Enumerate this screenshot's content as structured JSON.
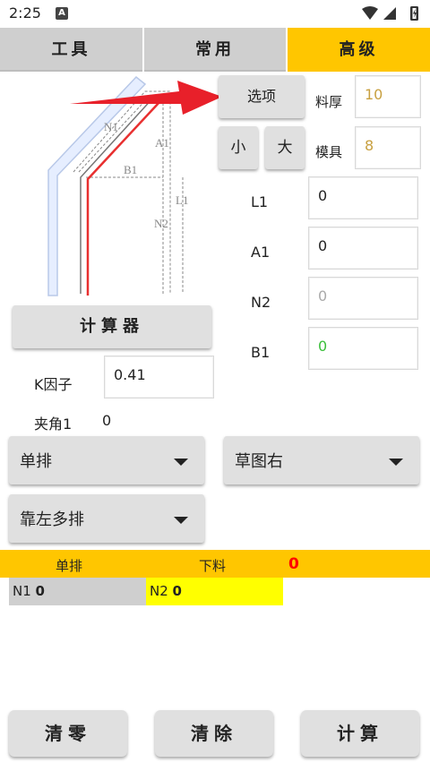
{
  "status": {
    "time": "2:25",
    "notification_letter": "A"
  },
  "tabs": [
    {
      "label": "工具"
    },
    {
      "label": "常用"
    },
    {
      "label": "高级"
    }
  ],
  "diagram": {
    "labels": {
      "n1": "N1",
      "a1": "A1",
      "b1": "B1",
      "l1": "L1",
      "n2": "N2"
    }
  },
  "options_button": "选项",
  "size_buttons": {
    "small": "小",
    "large": "大"
  },
  "thickness": {
    "label": "料厚",
    "value": "10"
  },
  "mold": {
    "label": "模具",
    "value": "8"
  },
  "params": [
    {
      "label": "L1",
      "value": "0"
    },
    {
      "label": "A1",
      "value": "0"
    },
    {
      "label": "N2",
      "value": "0"
    },
    {
      "label": "B1",
      "value": "0"
    }
  ],
  "calculator_button": "计算器",
  "k_factor": {
    "label": "K因子",
    "value": "0.41"
  },
  "angle": {
    "label": "夹角1",
    "value": "0"
  },
  "dropdowns": {
    "mode": "单排",
    "sketch": "草图右",
    "arrangement": "靠左多排"
  },
  "result": {
    "mode": "单排",
    "blank_label": "下料",
    "blank_value": "0"
  },
  "n_results": {
    "n1_label": "N1",
    "n1_value": "0",
    "n2_label": "N2",
    "n2_value": "0"
  },
  "bottom_buttons": {
    "clear_zero": "清零",
    "clear": "清除",
    "calculate": "计算"
  },
  "colors": {
    "accent": "#ffc600",
    "highlight": "#ffff00",
    "result_red": "#ff0000",
    "value_orange": "#c8a040",
    "value_green": "#3bbf3b",
    "arrow_red": "#e8202a"
  }
}
